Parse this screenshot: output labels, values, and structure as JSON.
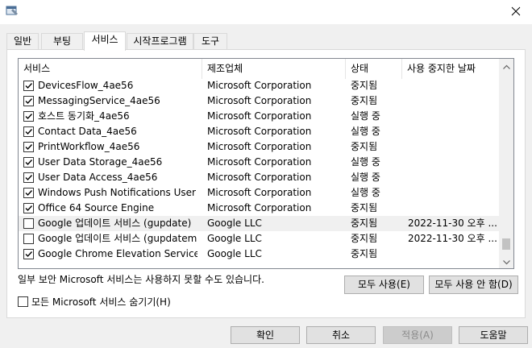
{
  "window": {
    "app_icon": "msconfig-icon",
    "close_icon": "close-icon"
  },
  "tabs": [
    {
      "label": "일반",
      "active": false
    },
    {
      "label": "부팅",
      "active": false
    },
    {
      "label": "서비스",
      "active": true
    },
    {
      "label": "시작프로그램",
      "active": false
    },
    {
      "label": "도구",
      "active": false
    }
  ],
  "columns": {
    "service": "서비스",
    "manufacturer": "제조업체",
    "status": "상태",
    "date_disabled": "사용 중지한 날짜"
  },
  "rows": [
    {
      "checked": true,
      "service": "DevicesFlow_4ae56",
      "manufacturer": "Microsoft Corporation",
      "status": "중지됨",
      "date": ""
    },
    {
      "checked": true,
      "service": "MessagingService_4ae56",
      "manufacturer": "Microsoft Corporation",
      "status": "중지됨",
      "date": ""
    },
    {
      "checked": true,
      "service": "호스트 동기화_4ae56",
      "manufacturer": "Microsoft Corporation",
      "status": "실행 중",
      "date": ""
    },
    {
      "checked": true,
      "service": "Contact Data_4ae56",
      "manufacturer": "Microsoft Corporation",
      "status": "실행 중",
      "date": ""
    },
    {
      "checked": true,
      "service": "PrintWorkflow_4ae56",
      "manufacturer": "Microsoft Corporation",
      "status": "중지됨",
      "date": ""
    },
    {
      "checked": true,
      "service": "User Data Storage_4ae56",
      "manufacturer": "Microsoft Corporation",
      "status": "실행 중",
      "date": ""
    },
    {
      "checked": true,
      "service": "User Data Access_4ae56",
      "manufacturer": "Microsoft Corporation",
      "status": "실행 중",
      "date": ""
    },
    {
      "checked": true,
      "service": "Windows Push Notifications User S...",
      "manufacturer": "Microsoft Corporation",
      "status": "실행 중",
      "date": ""
    },
    {
      "checked": true,
      "service": "Office 64 Source Engine",
      "manufacturer": "Microsoft Corporation",
      "status": "중지됨",
      "date": ""
    },
    {
      "checked": false,
      "service": "Google 업데이트 서비스 (gupdate)",
      "manufacturer": "Google LLC",
      "status": "중지됨",
      "date": "2022-11-30 오후 ...",
      "selected": true
    },
    {
      "checked": false,
      "service": "Google 업데이트 서비스 (gupdatem)",
      "manufacturer": "Google LLC",
      "status": "중지됨",
      "date": "2022-11-30 오후 ..."
    },
    {
      "checked": true,
      "service": "Google Chrome Elevation Service (...",
      "manufacturer": "Google LLC",
      "status": "중지됨",
      "date": ""
    }
  ],
  "note": "일부 보안 Microsoft 서비스는 사용하지 못할 수도 있습니다.",
  "enable_all": "모두 사용(E)",
  "disable_all": "모두 사용 안 함(D)",
  "hide_ms_label": "모든 Microsoft 서비스 숨기기(H)",
  "hide_ms_checked": false,
  "footer": {
    "ok": "확인",
    "cancel": "취소",
    "apply": "적용(A)",
    "help": "도움말"
  },
  "scrollbar": {
    "up_icon": "chevron-up-icon",
    "down_icon": "chevron-down-icon",
    "position": 0.97
  }
}
